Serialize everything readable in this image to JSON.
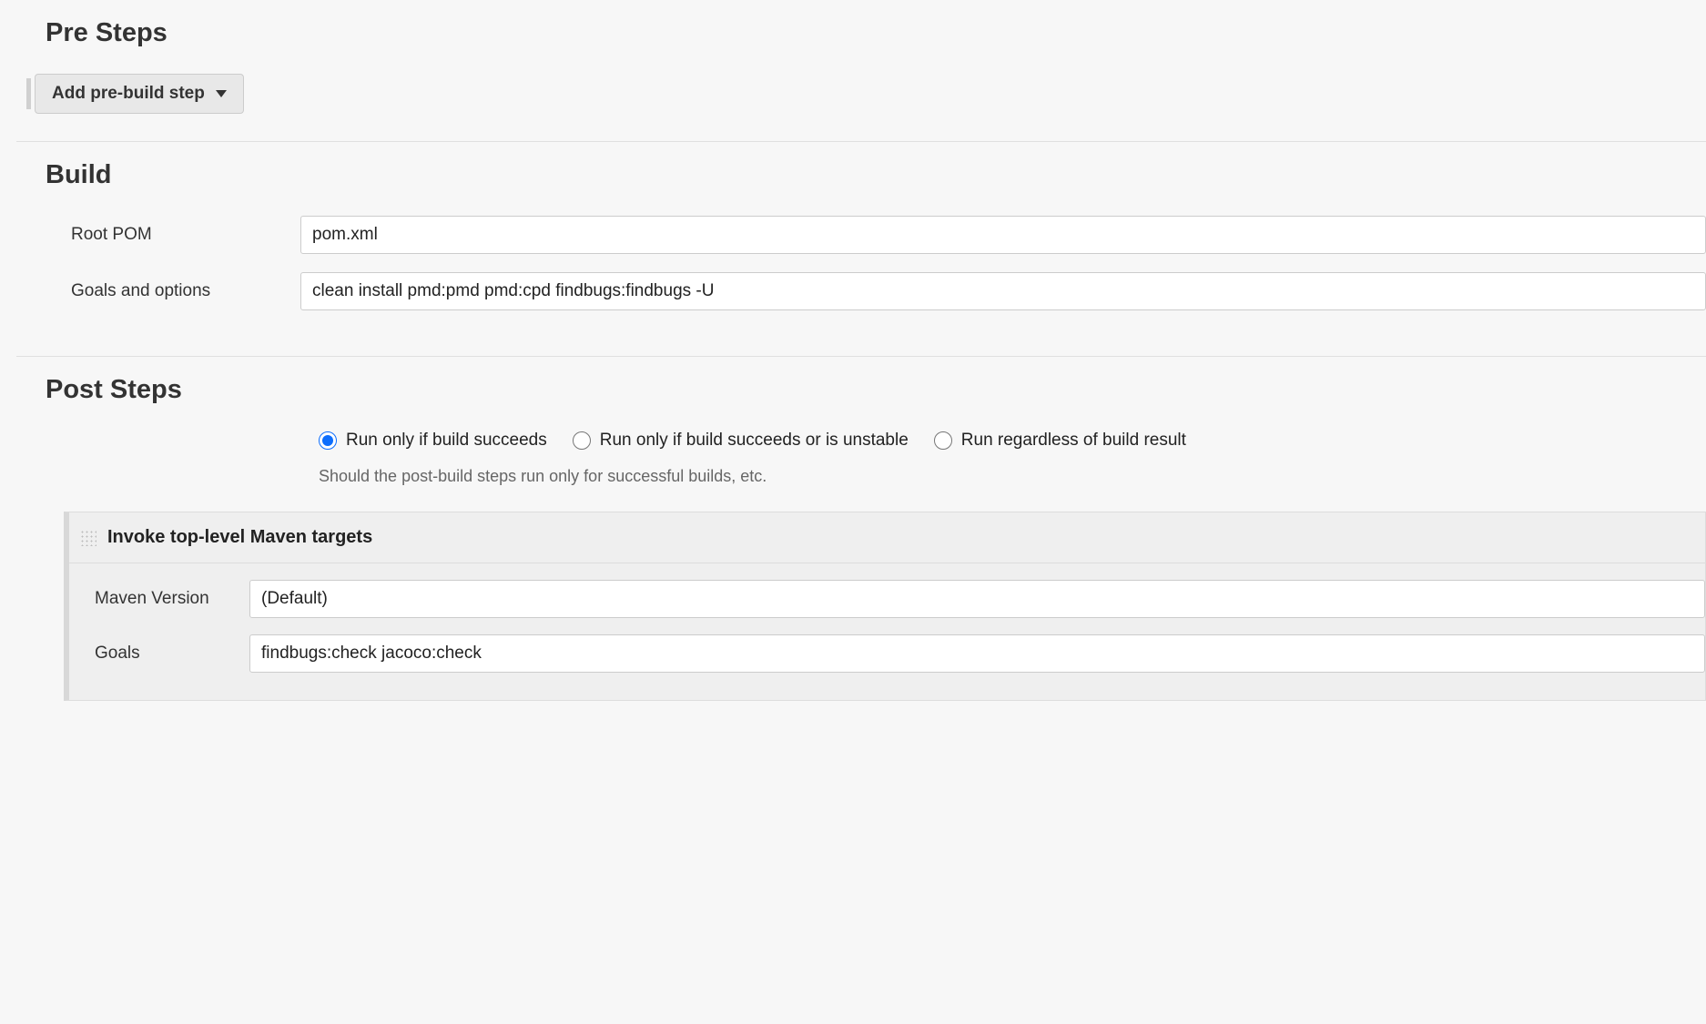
{
  "preSteps": {
    "title": "Pre Steps",
    "addButton": "Add pre-build step"
  },
  "build": {
    "title": "Build",
    "rootPomLabel": "Root POM",
    "rootPomValue": "pom.xml",
    "goalsLabel": "Goals and options",
    "goalsValue": "clean install pmd:pmd pmd:cpd findbugs:findbugs -U"
  },
  "postSteps": {
    "title": "Post Steps",
    "radios": {
      "succeeds": "Run only if build succeeds",
      "succeedsOrUnstable": "Run only if build succeeds or is unstable",
      "regardless": "Run regardless of build result"
    },
    "helpText": "Should the post-build steps run only for successful builds, etc.",
    "step": {
      "title": "Invoke top-level Maven targets",
      "mavenVersionLabel": "Maven Version",
      "mavenVersionValue": "(Default)",
      "goalsLabel": "Goals",
      "goalsValue": "findbugs:check jacoco:check"
    }
  }
}
